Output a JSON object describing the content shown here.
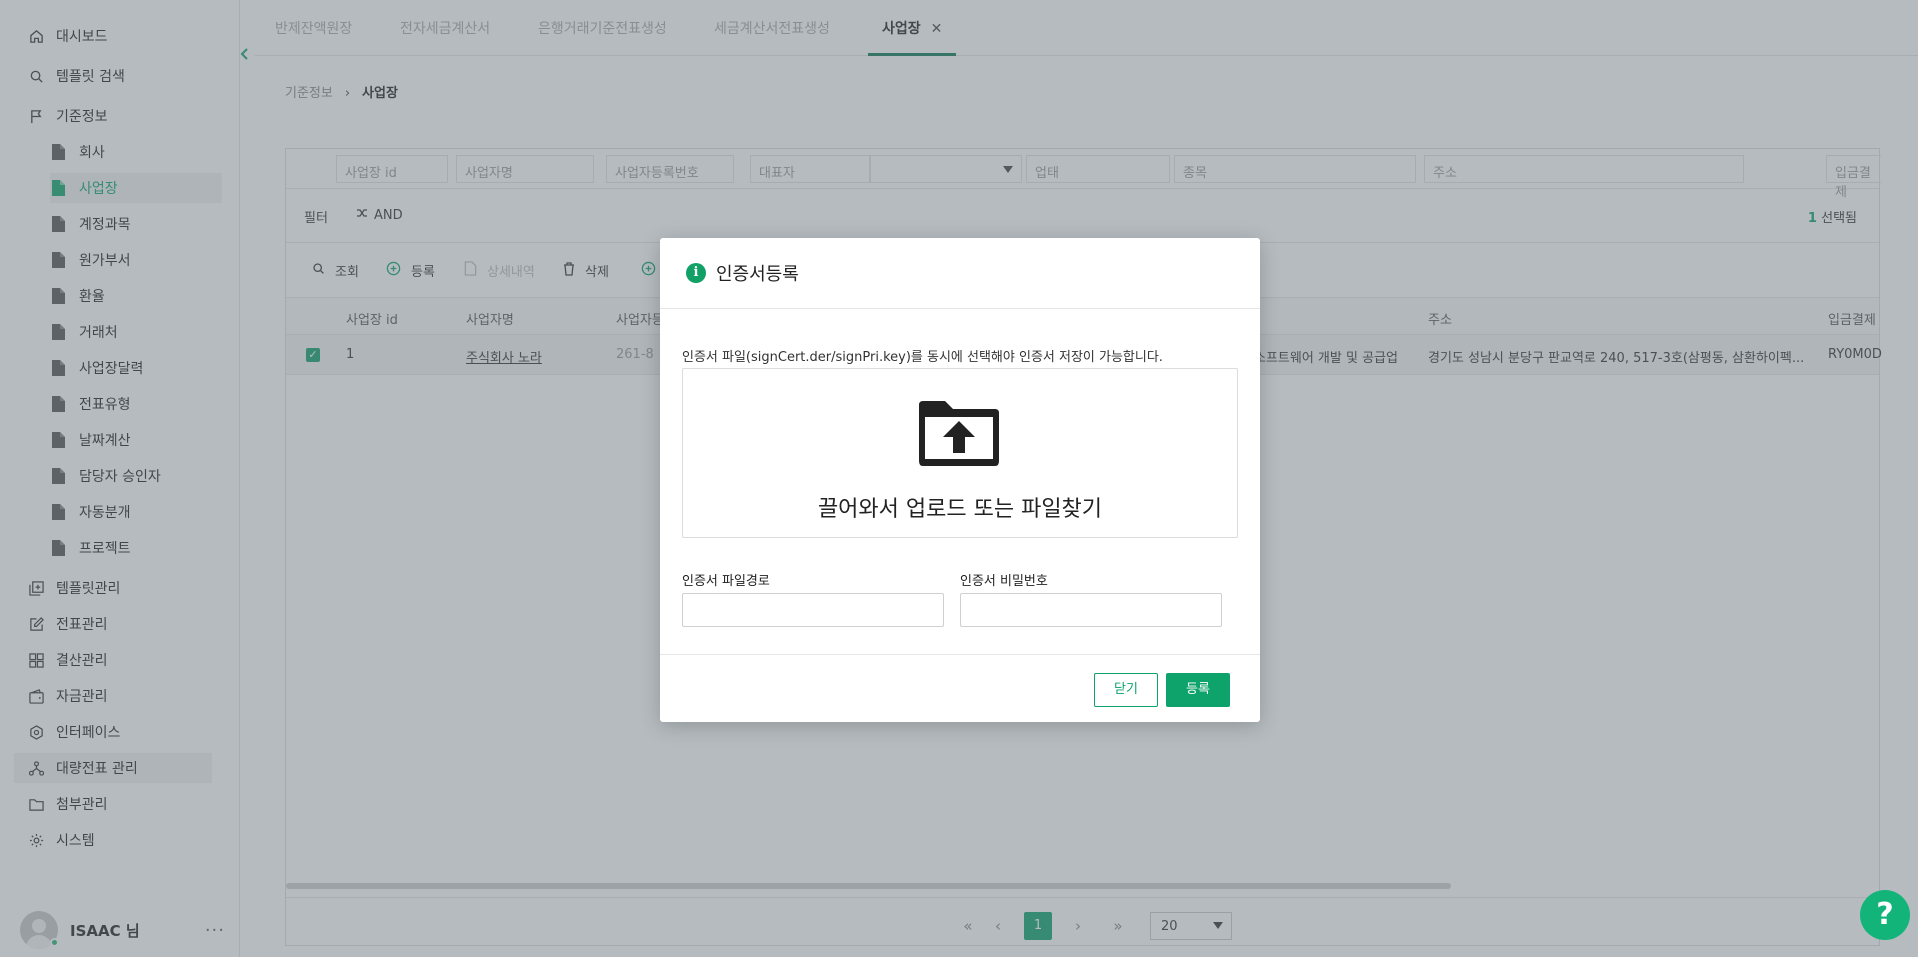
{
  "sidebar": {
    "dashboard": "대시보드",
    "template_search": "템플릿 검색",
    "basic_info": "기준정보",
    "sub_items": [
      "회사",
      "사업장",
      "계정과목",
      "원가부서",
      "환율",
      "거래처",
      "사업장달력",
      "전표유형",
      "날짜계산",
      "담당자 승인자",
      "자동분개",
      "프로젝트"
    ],
    "template_mgmt": "템플릿관리",
    "voucher_mgmt": "전표관리",
    "closing_mgmt": "결산관리",
    "fund_mgmt": "자금관리",
    "interface": "인터페이스",
    "bulk_voucher": "대량전표 관리",
    "attach_mgmt": "첨부관리",
    "system": "시스템",
    "user_name": "ISAAC 님",
    "user_more": "···"
  },
  "tabs": [
    "반제잔액원장",
    "전자세금계산서",
    "은행거래기준전표생성",
    "세금계산서전표생성",
    "사업장"
  ],
  "tab_close": "✕",
  "breadcrumb": {
    "parent": "기준정보",
    "sep": "›",
    "current": "사업장"
  },
  "grid": {
    "filter_placeholders": [
      "사업장 id",
      "사업자명",
      "사업자등록번호",
      "대표자",
      "업태",
      "종목",
      "주소",
      "입금결제"
    ],
    "filter_label": "필터",
    "and_label": "AND",
    "selected_count": "1",
    "selected_suffix": "선택됨",
    "toolbar": {
      "search": "조회",
      "register": "등록",
      "detail": "상세내역",
      "delete": "삭제"
    },
    "columns": [
      "사업장 id",
      "사업자명",
      "사업자등",
      "주소",
      "입금결제"
    ],
    "row": {
      "id": "1",
      "name": "주식회사 노라",
      "reg_no": "261-8",
      "item": "소프트웨어 개발 및 공급업",
      "address": "경기도 성남시 분당구 판교역로 240, 517-3호(삼평동, 삼환하이펙...",
      "payment": "RY0M0D"
    },
    "pager": {
      "first": "«",
      "prev": "‹",
      "current": "1",
      "next": "›",
      "last": "»",
      "page_size": "20"
    }
  },
  "modal": {
    "title": "인증서등록",
    "notice": "인증서 파일(signCert.der/signPri.key)를 동시에 선택해야 인증서 저장이 가능합니다.",
    "drop_text": "끌어와서 업로드 또는 파일찾기",
    "path_label": "인증서 파일경로",
    "password_label": "인증서 비밀번호",
    "path_value": "",
    "password_value": "",
    "close_label": "닫기",
    "register_label": "등록"
  },
  "help_label": "?",
  "colors": {
    "accent": "#0ea36b",
    "overlay": "rgba(100,112,122,0.48)"
  }
}
